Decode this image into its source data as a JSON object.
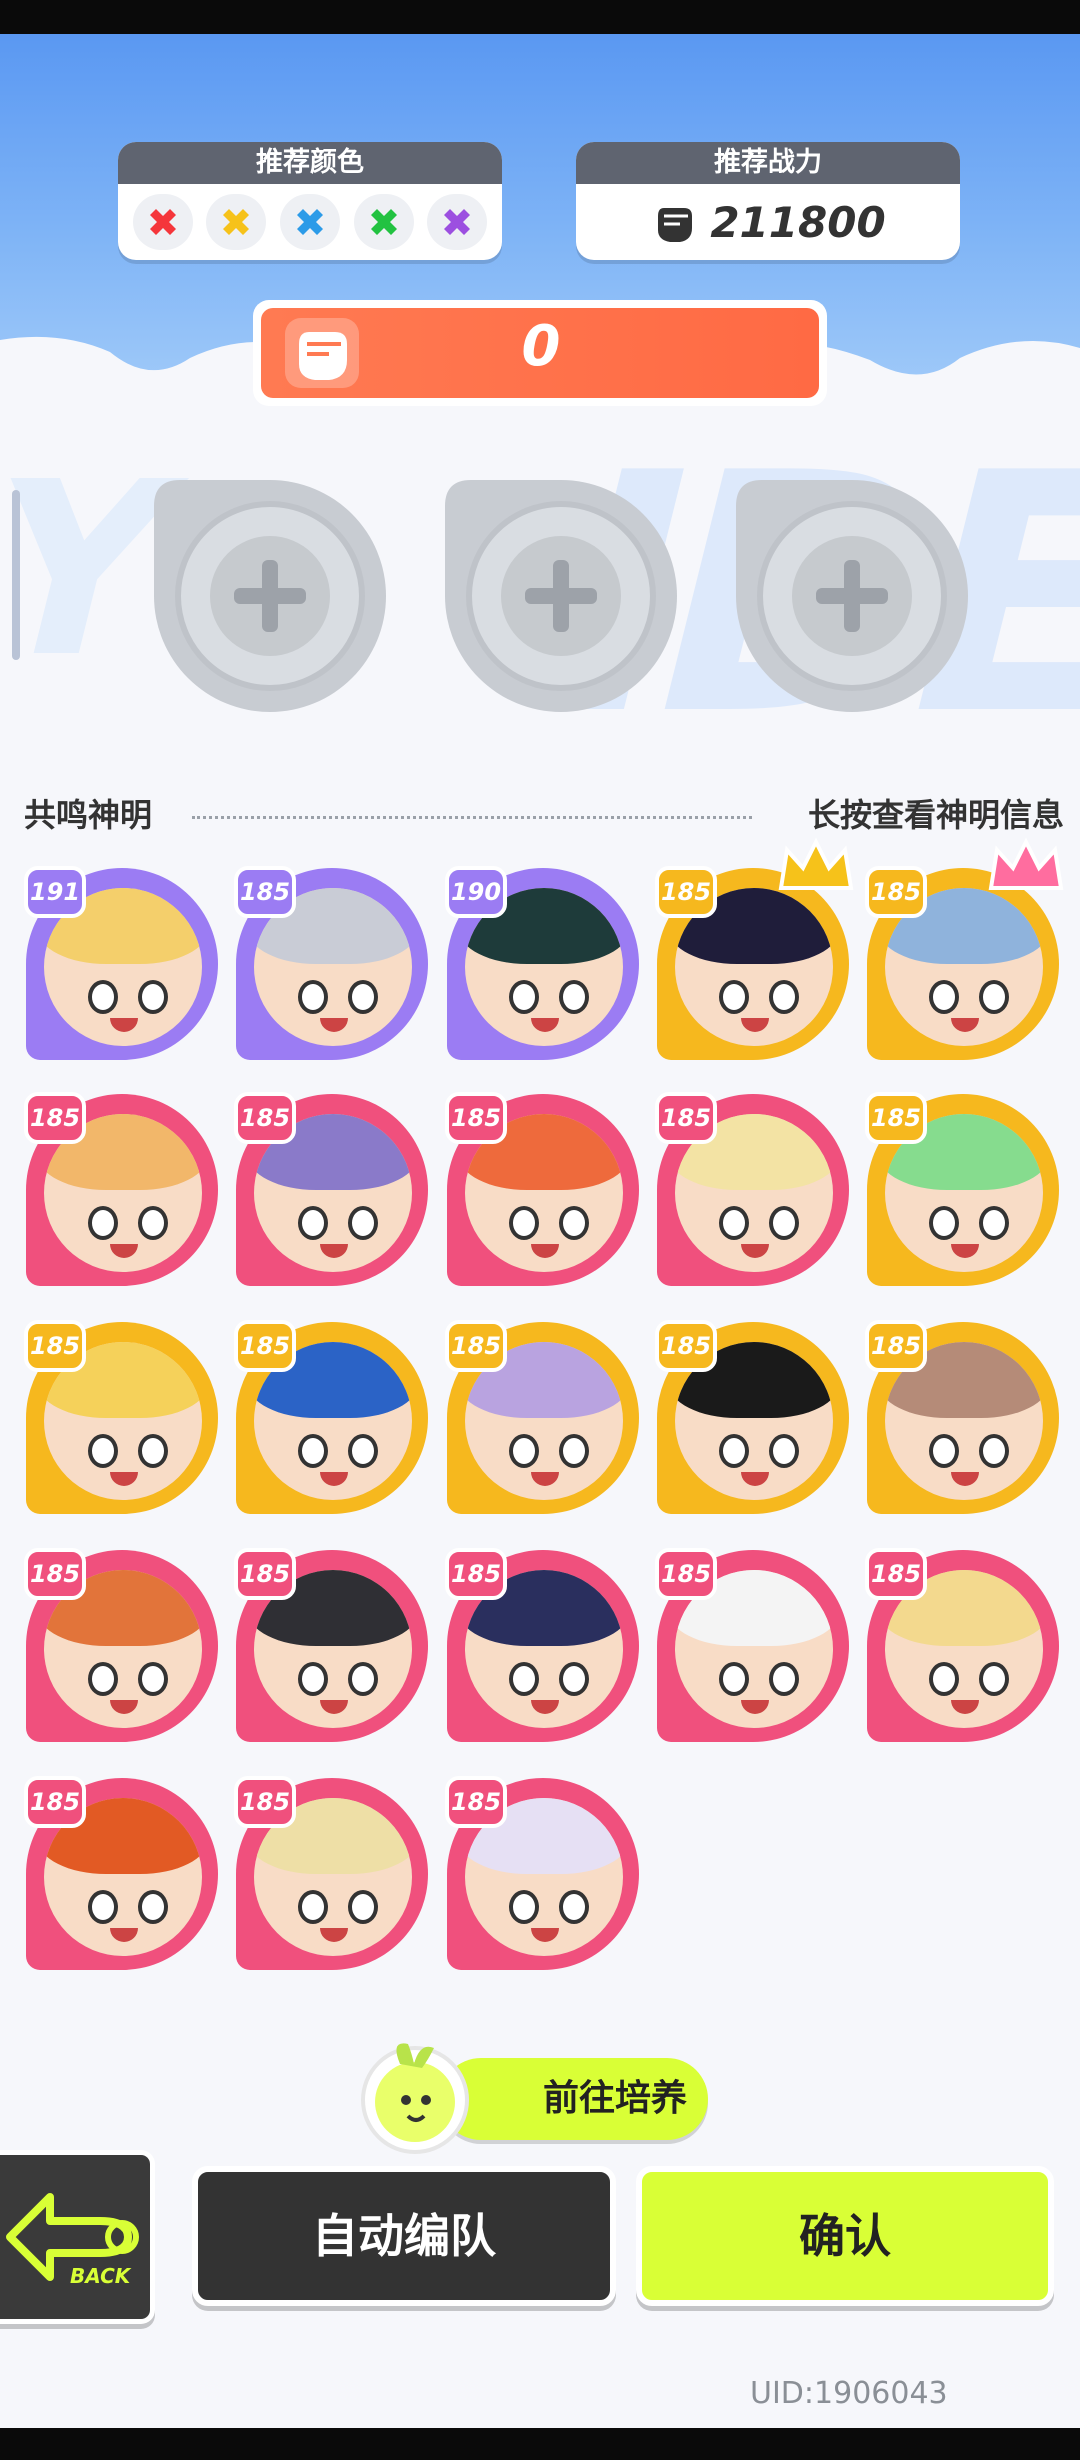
{
  "recommend_color": {
    "title": "推荐颜色",
    "colors": [
      "#f5363b",
      "#f6c21a",
      "#2c9be8",
      "#22c241",
      "#9c4fe0"
    ]
  },
  "recommend_power": {
    "title": "推荐战力",
    "value": "211800"
  },
  "current_power": "0",
  "slots": [
    "empty",
    "empty",
    "empty"
  ],
  "section": {
    "left_label": "共鸣神明",
    "right_label": "长按查看神明信息"
  },
  "characters": [
    {
      "level": "191",
      "ring": "#9b7cf3",
      "hair": "#f4cf6b",
      "crown": ""
    },
    {
      "level": "185",
      "ring": "#9b7cf3",
      "hair": "#c9ccd6",
      "crown": ""
    },
    {
      "level": "190",
      "ring": "#9b7cf3",
      "hair": "#1e3b3a",
      "crown": ""
    },
    {
      "level": "185",
      "ring": "#f6b81e",
      "hair": "#1f1d3a",
      "crown": "#f6c21a"
    },
    {
      "level": "185",
      "ring": "#f6b81e",
      "hair": "#8fb3dc",
      "crown": "#ff6d9f"
    },
    {
      "level": "185",
      "ring": "#f0507d",
      "hair": "#f2b76a",
      "crown": ""
    },
    {
      "level": "185",
      "ring": "#f0507d",
      "hair": "#8a7ac9",
      "crown": ""
    },
    {
      "level": "185",
      "ring": "#f0507d",
      "hair": "#ee6a3c",
      "crown": ""
    },
    {
      "level": "185",
      "ring": "#f0507d",
      "hair": "#f3e3a4",
      "crown": ""
    },
    {
      "level": "185",
      "ring": "#f6b81e",
      "hair": "#86dc8e",
      "crown": ""
    },
    {
      "level": "185",
      "ring": "#f6b81e",
      "hair": "#f5d15a",
      "crown": ""
    },
    {
      "level": "185",
      "ring": "#f6b81e",
      "hair": "#2b63c6",
      "crown": ""
    },
    {
      "level": "185",
      "ring": "#f6b81e",
      "hair": "#b9a3e0",
      "crown": ""
    },
    {
      "level": "185",
      "ring": "#f6b81e",
      "hair": "#1a1a1a",
      "crown": ""
    },
    {
      "level": "185",
      "ring": "#f6b81e",
      "hair": "#b58b78",
      "crown": ""
    },
    {
      "level": "185",
      "ring": "#f0507d",
      "hair": "#e2743a",
      "crown": ""
    },
    {
      "level": "185",
      "ring": "#f0507d",
      "hair": "#2f2f34",
      "crown": ""
    },
    {
      "level": "185",
      "ring": "#f0507d",
      "hair": "#2a2f5e",
      "crown": ""
    },
    {
      "level": "185",
      "ring": "#f0507d",
      "hair": "#f4f4f4",
      "crown": ""
    },
    {
      "level": "185",
      "ring": "#f0507d",
      "hair": "#f3d98e",
      "crown": ""
    },
    {
      "level": "185",
      "ring": "#f0507d",
      "hair": "#e25a24",
      "crown": ""
    },
    {
      "level": "185",
      "ring": "#f0507d",
      "hair": "#eedfa6",
      "crown": ""
    },
    {
      "level": "185",
      "ring": "#f0507d",
      "hair": "#e6e0f4",
      "crown": ""
    }
  ],
  "buttons": {
    "train": "前往培养",
    "back": "BACK",
    "auto": "自动编队",
    "confirm": "确认"
  },
  "uid": "UID:1906043"
}
